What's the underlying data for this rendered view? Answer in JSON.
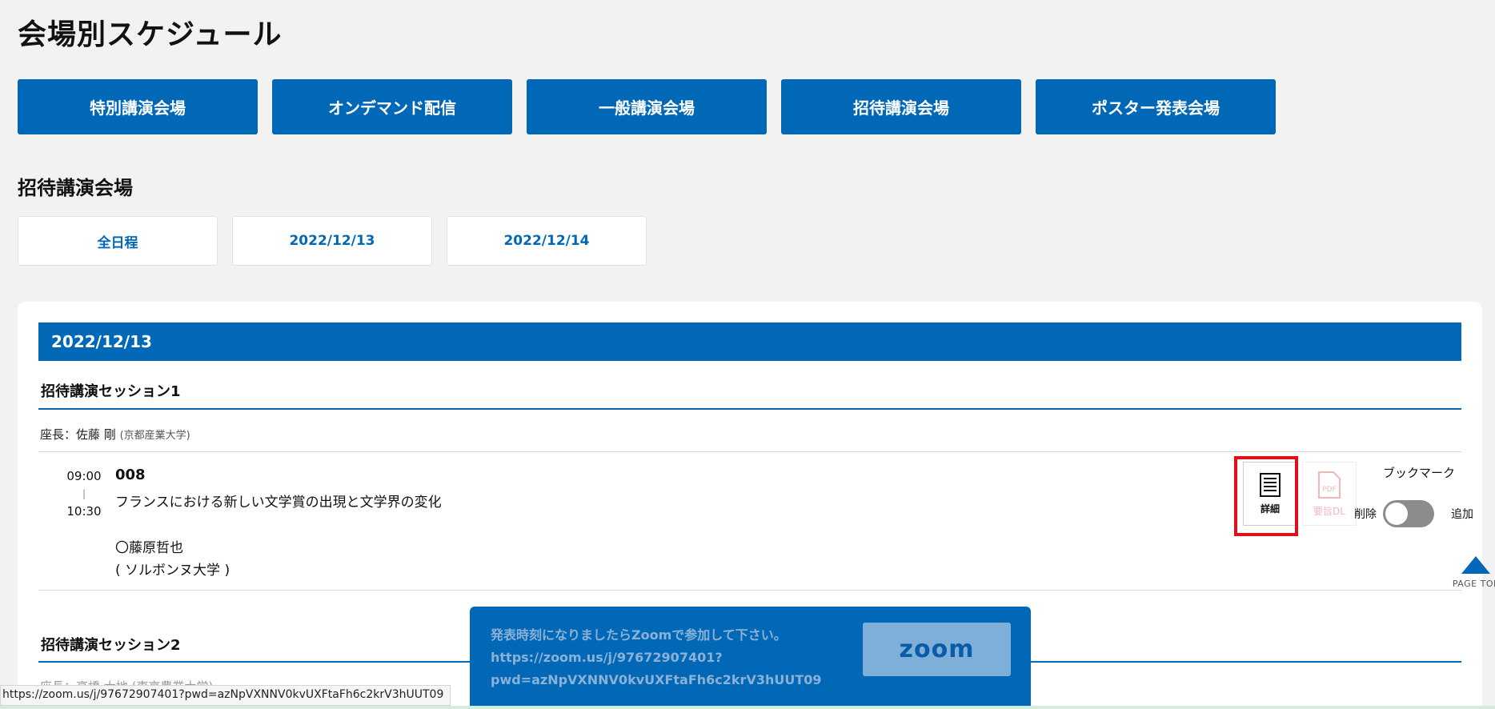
{
  "page": {
    "title": "会場別スケジュール"
  },
  "venues": [
    "特別講演会場",
    "オンデマンド配信",
    "一般講演会場",
    "招待講演会場",
    "ポスター発表会場"
  ],
  "section": {
    "title": "招待講演会場"
  },
  "date_tabs": [
    "全日程",
    "2022/12/13",
    "2022/12/14"
  ],
  "day": {
    "label": "2022/12/13"
  },
  "session1": {
    "title": "招待講演セッション1",
    "chair_prefix": "座長：佐藤 剛",
    "chair_affiliation": "(京都産業大学)",
    "talk": {
      "start": "09:00",
      "sep": "|",
      "end": "10:30",
      "number": "008",
      "title": "フランスにおける新しい文学賞の出現と文学界の変化",
      "author": "〇藤原哲也",
      "affiliation": "( ソルボンヌ大学 )"
    },
    "detail_label": "詳細",
    "pdf_label": "要旨DL",
    "pdf_icon_text": "PDF"
  },
  "bookmark": {
    "label": "ブックマーク",
    "remove": "削除",
    "add": "追加",
    "state": "off"
  },
  "session2": {
    "title": "招待講演セッション2",
    "chair_partial": "座長：高橋 大地 (東京農業大学)"
  },
  "zoom": {
    "line1": "発表時刻になりましたらZoomで参加して下さい。",
    "line2": "https://zoom.us/j/97672907401?",
    "line3": "pwd=azNpVXNNV0kvUXFtaFh6c2krV3hUUT09",
    "button_label": "zoom"
  },
  "page_top": {
    "label": "PAGE TOP"
  },
  "status_bar": {
    "url": "https://zoom.us/j/97672907401?pwd=azNpVXNNV0kvUXFtaFh6c2krV3hUUT09"
  },
  "colors": {
    "primary": "#0068b7",
    "highlight": "#e0101a",
    "background": "#f2f2f2"
  }
}
